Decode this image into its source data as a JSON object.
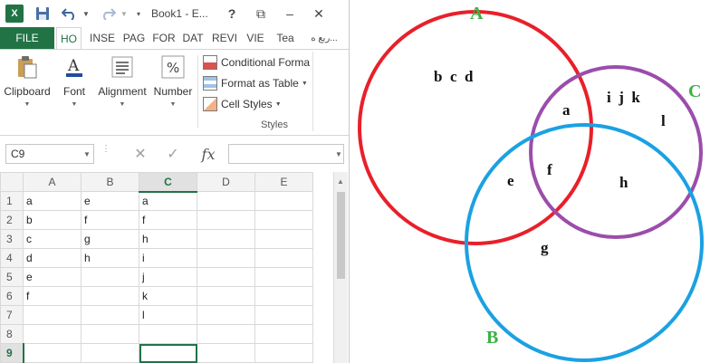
{
  "window": {
    "app_icon_text": "X",
    "title": "Book1 - E...",
    "help": "?",
    "restore": "⧉",
    "minimize": "–",
    "close": "✕"
  },
  "ribbon_tabs": {
    "file": "FILE",
    "tabs": [
      {
        "label": "HO",
        "active": true
      },
      {
        "label": "INSE",
        "active": false
      },
      {
        "label": "PAG",
        "active": false
      },
      {
        "label": "FOR",
        "active": false
      },
      {
        "label": "DAT",
        "active": false
      },
      {
        "label": "REVI",
        "active": false
      },
      {
        "label": "VIE",
        "active": false
      },
      {
        "label": "Tea",
        "active": false
      },
      {
        "label": "ربع ه...",
        "active": false
      }
    ]
  },
  "ribbon": {
    "clipboard": "Clipboard",
    "font": "Font",
    "alignment": "Alignment",
    "number": "Number",
    "conditional_formatting": "Conditional Forma",
    "format_as_table": "Format as Table",
    "cell_styles": "Cell Styles",
    "styles_group": "Styles"
  },
  "formula_bar": {
    "name_box": "C9",
    "fx": "fx",
    "formula": ""
  },
  "sheet": {
    "columns": [
      "A",
      "B",
      "C",
      "D",
      "E"
    ],
    "active_column": "C",
    "active_row": "9",
    "rows": [
      {
        "num": "1",
        "cells": [
          "a",
          "e",
          "a",
          "",
          ""
        ]
      },
      {
        "num": "2",
        "cells": [
          "b",
          "f",
          "f",
          "",
          ""
        ]
      },
      {
        "num": "3",
        "cells": [
          "c",
          "g",
          "h",
          "",
          ""
        ]
      },
      {
        "num": "4",
        "cells": [
          "d",
          "h",
          "i",
          "",
          ""
        ]
      },
      {
        "num": "5",
        "cells": [
          "e",
          "",
          "j",
          "",
          ""
        ]
      },
      {
        "num": "6",
        "cells": [
          "f",
          "",
          "k",
          "",
          ""
        ]
      },
      {
        "num": "7",
        "cells": [
          "",
          "",
          "l",
          "",
          ""
        ]
      },
      {
        "num": "8",
        "cells": [
          "",
          "",
          "",
          "",
          ""
        ]
      },
      {
        "num": "9",
        "cells": [
          "",
          "",
          "",
          "",
          ""
        ]
      }
    ]
  },
  "venn": {
    "sets": {
      "A": "A",
      "B": "B",
      "C": "C"
    },
    "colors": {
      "A": "#e8202a",
      "B": "#1ba1e2",
      "C": "#9b4dab",
      "label": "#3cb043"
    },
    "regions": {
      "a_only": "b  c  d",
      "c_only_top": "i  j  k",
      "c_only_bottom": "l",
      "a_c": "a",
      "a_b": "e",
      "a_b_c": "f",
      "b_c": "h",
      "b_only": "g"
    }
  }
}
